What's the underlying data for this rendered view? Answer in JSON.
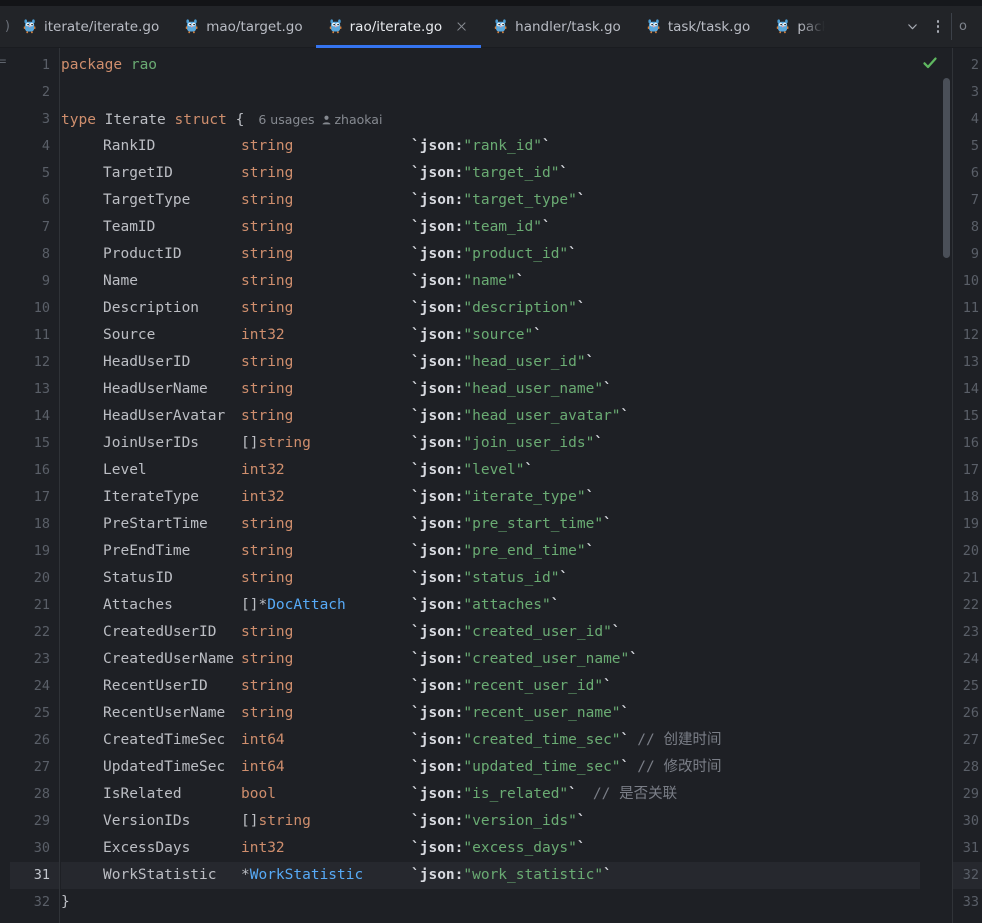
{
  "window": {
    "app": "GoLand",
    "theme_bg": "#1e2025",
    "accent": "#3574f0",
    "active_tab_underline": "#3574f0"
  },
  "tabbar": {
    "edge_left_glyph": ")",
    "tail_glyph": "o",
    "chevron_label": "chevron-down",
    "more_label": "more-options",
    "tabs": [
      {
        "label": "iterate/iterate.go",
        "icon": "go-file-icon",
        "active": false,
        "closable": false,
        "truncated": false
      },
      {
        "label": "mao/target.go",
        "icon": "go-file-icon",
        "active": false,
        "closable": false,
        "truncated": false
      },
      {
        "label": "rao/iterate.go",
        "icon": "go-file-icon",
        "active": true,
        "closable": true,
        "truncated": false
      },
      {
        "label": "handler/task.go",
        "icon": "go-file-icon",
        "active": false,
        "closable": false,
        "truncated": false
      },
      {
        "label": "task/task.go",
        "icon": "go-file-icon",
        "active": false,
        "closable": false,
        "truncated": false
      },
      {
        "label": "pack",
        "icon": "go-file-icon",
        "active": false,
        "closable": false,
        "truncated": true
      }
    ]
  },
  "editor": {
    "left_edge_glyph": "=",
    "current_line": 31,
    "inspection_status": "ok",
    "inspection_color": "#5fb760",
    "line_numbers": [
      1,
      2,
      3,
      4,
      5,
      6,
      7,
      8,
      9,
      10,
      11,
      12,
      13,
      14,
      15,
      16,
      17,
      18,
      19,
      20,
      21,
      22,
      23,
      24,
      25,
      26,
      27,
      28,
      29,
      30,
      31,
      32
    ],
    "code_lens": {
      "usages": "6 usages",
      "author": "zhaokai"
    },
    "lines": [
      {
        "n": 1,
        "kind": "package",
        "kw": "package",
        "name": "rao"
      },
      {
        "n": 2,
        "kind": "blank"
      },
      {
        "n": 3,
        "kind": "structdecl",
        "kw1": "type",
        "name": "Iterate",
        "kw2": "struct",
        "brace": "{"
      },
      {
        "n": 4,
        "kind": "field",
        "name": "RankID",
        "type": "string",
        "type_kind": "builtin",
        "tag_key": "`json:",
        "tag_val": "\"rank_id\"",
        "tag_end": "`",
        "comment": ""
      },
      {
        "n": 5,
        "kind": "field",
        "name": "TargetID",
        "type": "string",
        "type_kind": "builtin",
        "tag_key": "`json:",
        "tag_val": "\"target_id\"",
        "tag_end": "`",
        "comment": ""
      },
      {
        "n": 6,
        "kind": "field",
        "name": "TargetType",
        "type": "string",
        "type_kind": "builtin",
        "tag_key": "`json:",
        "tag_val": "\"target_type\"",
        "tag_end": "`",
        "comment": ""
      },
      {
        "n": 7,
        "kind": "field",
        "name": "TeamID",
        "type": "string",
        "type_kind": "builtin",
        "tag_key": "`json:",
        "tag_val": "\"team_id\"",
        "tag_end": "`",
        "comment": ""
      },
      {
        "n": 8,
        "kind": "field",
        "name": "ProductID",
        "type": "string",
        "type_kind": "builtin",
        "tag_key": "`json:",
        "tag_val": "\"product_id\"",
        "tag_end": "`",
        "comment": ""
      },
      {
        "n": 9,
        "kind": "field",
        "name": "Name",
        "type": "string",
        "type_kind": "builtin",
        "tag_key": "`json:",
        "tag_val": "\"name\"",
        "tag_end": "`",
        "comment": ""
      },
      {
        "n": 10,
        "kind": "field",
        "name": "Description",
        "type": "string",
        "type_kind": "builtin",
        "tag_key": "`json:",
        "tag_val": "\"description\"",
        "tag_end": "`",
        "comment": ""
      },
      {
        "n": 11,
        "kind": "field",
        "name": "Source",
        "type": "int32",
        "type_kind": "builtin",
        "tag_key": "`json:",
        "tag_val": "\"source\"",
        "tag_end": "`",
        "comment": ""
      },
      {
        "n": 12,
        "kind": "field",
        "name": "HeadUserID",
        "type": "string",
        "type_kind": "builtin",
        "tag_key": "`json:",
        "tag_val": "\"head_user_id\"",
        "tag_end": "`",
        "comment": ""
      },
      {
        "n": 13,
        "kind": "field",
        "name": "HeadUserName",
        "type": "string",
        "type_kind": "builtin",
        "tag_key": "`json:",
        "tag_val": "\"head_user_name\"",
        "tag_end": "`",
        "comment": ""
      },
      {
        "n": 14,
        "kind": "field",
        "name": "HeadUserAvatar",
        "type": "string",
        "type_kind": "builtin",
        "tag_key": "`json:",
        "tag_val": "\"head_user_avatar\"",
        "tag_end": "`",
        "comment": ""
      },
      {
        "n": 15,
        "kind": "field",
        "name": "JoinUserIDs",
        "type": "[]string",
        "type_kind": "slice",
        "type_prefix": "[]",
        "type_core": "string",
        "tag_key": "`json:",
        "tag_val": "\"join_user_ids\"",
        "tag_end": "`",
        "comment": ""
      },
      {
        "n": 16,
        "kind": "field",
        "name": "Level",
        "type": "int32",
        "type_kind": "builtin",
        "tag_key": "`json:",
        "tag_val": "\"level\"",
        "tag_end": "`",
        "comment": ""
      },
      {
        "n": 17,
        "kind": "field",
        "name": "IterateType",
        "type": "int32",
        "type_kind": "builtin",
        "tag_key": "`json:",
        "tag_val": "\"iterate_type\"",
        "tag_end": "`",
        "comment": ""
      },
      {
        "n": 18,
        "kind": "field",
        "name": "PreStartTime",
        "type": "string",
        "type_kind": "builtin",
        "tag_key": "`json:",
        "tag_val": "\"pre_start_time\"",
        "tag_end": "`",
        "comment": ""
      },
      {
        "n": 19,
        "kind": "field",
        "name": "PreEndTime",
        "type": "string",
        "type_kind": "builtin",
        "tag_key": "`json:",
        "tag_val": "\"pre_end_time\"",
        "tag_end": "`",
        "comment": ""
      },
      {
        "n": 20,
        "kind": "field",
        "name": "StatusID",
        "type": "string",
        "type_kind": "builtin",
        "tag_key": "`json:",
        "tag_val": "\"status_id\"",
        "tag_end": "`",
        "comment": ""
      },
      {
        "n": 21,
        "kind": "field",
        "name": "Attaches",
        "type": "[]*DocAttach",
        "type_kind": "usertype",
        "type_prefix": "[]*",
        "type_core": "DocAttach",
        "tag_key": "`json:",
        "tag_val": "\"attaches\"",
        "tag_end": "`",
        "comment": ""
      },
      {
        "n": 22,
        "kind": "field",
        "name": "CreatedUserID",
        "type": "string",
        "type_kind": "builtin",
        "tag_key": "`json:",
        "tag_val": "\"created_user_id\"",
        "tag_end": "`",
        "comment": ""
      },
      {
        "n": 23,
        "kind": "field",
        "name": "CreatedUserName",
        "type": "string",
        "type_kind": "builtin",
        "tag_key": "`json:",
        "tag_val": "\"created_user_name\"",
        "tag_end": "`",
        "comment": ""
      },
      {
        "n": 24,
        "kind": "field",
        "name": "RecentUserID",
        "type": "string",
        "type_kind": "builtin",
        "tag_key": "`json:",
        "tag_val": "\"recent_user_id\"",
        "tag_end": "`",
        "comment": ""
      },
      {
        "n": 25,
        "kind": "field",
        "name": "RecentUserName",
        "type": "string",
        "type_kind": "builtin",
        "tag_key": "`json:",
        "tag_val": "\"recent_user_name\"",
        "tag_end": "`",
        "comment": ""
      },
      {
        "n": 26,
        "kind": "field",
        "name": "CreatedTimeSec",
        "type": "int64",
        "type_kind": "builtin",
        "tag_key": "`json:",
        "tag_val": "\"created_time_sec\"",
        "tag_end": "`",
        "comment": "// 创建时间"
      },
      {
        "n": 27,
        "kind": "field",
        "name": "UpdatedTimeSec",
        "type": "int64",
        "type_kind": "builtin",
        "tag_key": "`json:",
        "tag_val": "\"updated_time_sec\"",
        "tag_end": "`",
        "comment": "// 修改时间"
      },
      {
        "n": 28,
        "kind": "field",
        "name": "IsRelated",
        "type": "bool",
        "type_kind": "builtin",
        "tag_key": "`json:",
        "tag_val": "\"is_related\"",
        "tag_end": "`",
        "comment": "// 是否关联",
        "comment_pad": 8
      },
      {
        "n": 29,
        "kind": "field",
        "name": "VersionIDs",
        "type": "[]string",
        "type_kind": "slice",
        "type_prefix": "[]",
        "type_core": "string",
        "tag_key": "`json:",
        "tag_val": "\"version_ids\"",
        "tag_end": "`",
        "comment": ""
      },
      {
        "n": 30,
        "kind": "field",
        "name": "ExcessDays",
        "type": "int32",
        "type_kind": "builtin",
        "tag_key": "`json:",
        "tag_val": "\"excess_days\"",
        "tag_end": "`",
        "comment": ""
      },
      {
        "n": 31,
        "kind": "field",
        "name": "WorkStatistic",
        "type": "*WorkStatistic",
        "type_kind": "usertype",
        "type_prefix": "*",
        "type_core": "WorkStatistic",
        "tag_key": "`json:",
        "tag_val": "\"work_statistic\"",
        "tag_end": "`",
        "comment": "",
        "current": true
      },
      {
        "n": 32,
        "kind": "closebrace",
        "brace": "}"
      }
    ]
  },
  "right_panel": {
    "line_numbers": [
      2,
      3,
      4,
      5,
      6,
      7,
      8,
      9,
      10,
      11,
      12,
      13,
      14,
      15,
      16,
      17,
      18,
      19,
      20,
      21,
      22,
      23,
      24,
      25,
      26,
      27,
      28,
      29,
      30,
      31,
      32,
      33
    ],
    "highlight_line": 32
  }
}
